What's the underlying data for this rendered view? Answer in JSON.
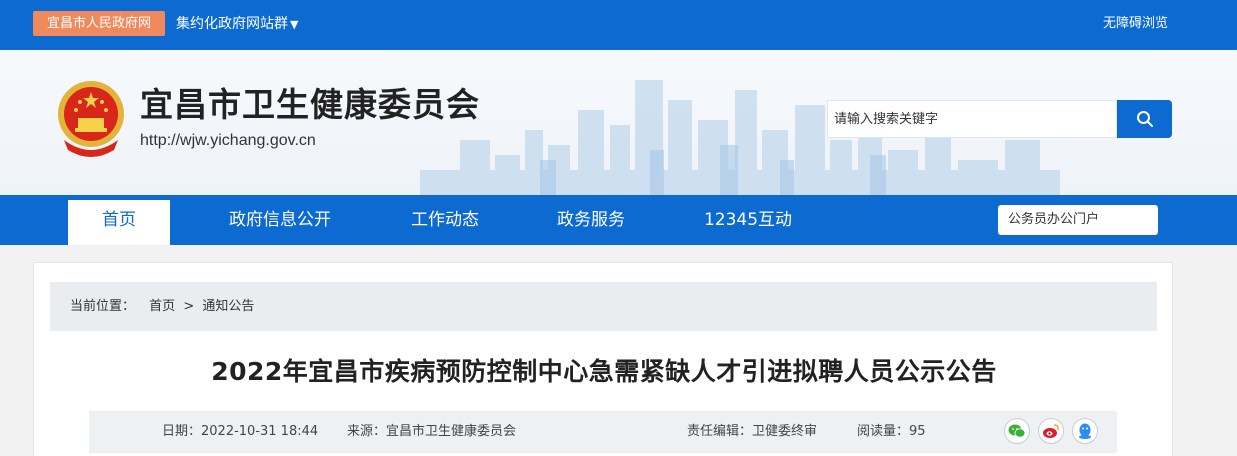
{
  "topbar": {
    "portal_link": "宜昌市人民政府网",
    "sites_link": "集约化政府网站群",
    "accessibility_link": "无障碍浏览"
  },
  "header": {
    "site_title": "宜昌市卫生健康委员会",
    "site_url": "http://wjw.yichang.gov.cn",
    "search_placeholder": "请输入搜索关键字"
  },
  "nav": {
    "items": [
      {
        "label": "首页",
        "active": true
      },
      {
        "label": "政府信息公开"
      },
      {
        "label": "工作动态"
      },
      {
        "label": "政务服务"
      },
      {
        "label": "12345互动"
      }
    ],
    "portal_button": "公务员办公门户"
  },
  "breadcrumb": {
    "label": "当前位置：",
    "items": [
      "首页",
      ">",
      "通知公告"
    ]
  },
  "article": {
    "title": "2022年宜昌市疾病预防控制中心急需紧缺人才引进拟聘人员公示公告",
    "meta": {
      "date": "日期：2022-10-31 18:44",
      "source": "来源：宜昌市卫生健康委员会",
      "editor": "责任编辑：卫健委终审",
      "views": "阅读量：95"
    },
    "share_icons": [
      "wechat-icon",
      "weibo-icon",
      "qq-icon"
    ]
  },
  "colors": {
    "primary": "#0c6ad1",
    "portal_link_bg": "#f08a5d",
    "meta_bg": "#eef1f4"
  }
}
